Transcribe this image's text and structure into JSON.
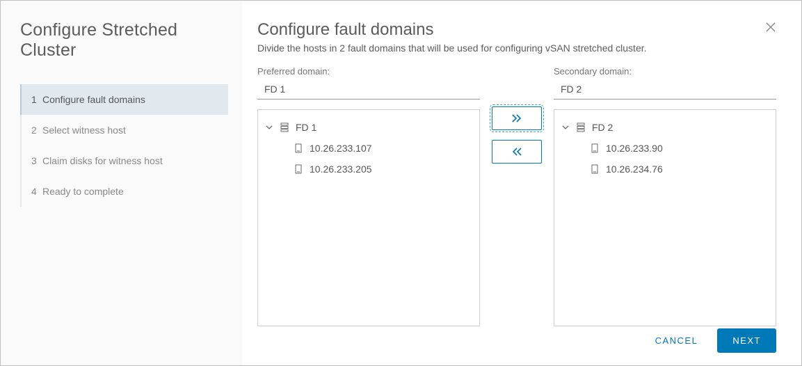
{
  "wizard": {
    "title": "Configure Stretched Cluster",
    "steps": [
      {
        "num": "1",
        "label": "Configure fault domains",
        "active": true
      },
      {
        "num": "2",
        "label": "Select witness host",
        "active": false
      },
      {
        "num": "3",
        "label": "Claim disks for witness host",
        "active": false
      },
      {
        "num": "4",
        "label": "Ready to complete",
        "active": false
      }
    ]
  },
  "page": {
    "title": "Configure fault domains",
    "subtitle": "Divide the hosts in 2 fault domains that will be used for configuring vSAN stretched cluster."
  },
  "preferred": {
    "label": "Preferred domain:",
    "value": "FD 1",
    "root": "FD 1",
    "hosts": [
      "10.26.233.107",
      "10.26.233.205"
    ]
  },
  "secondary": {
    "label": "Secondary domain:",
    "value": "FD 2",
    "root": "FD 2",
    "hosts": [
      "10.26.233.90",
      "10.26.234.76"
    ]
  },
  "footer": {
    "cancel": "CANCEL",
    "next": "NEXT"
  },
  "icons": {
    "close": "close-icon",
    "caret": "chevron-down-icon",
    "domain": "server-stack-icon",
    "host": "host-icon",
    "right": "double-chevron-right-icon",
    "left": "double-chevron-left-icon"
  }
}
